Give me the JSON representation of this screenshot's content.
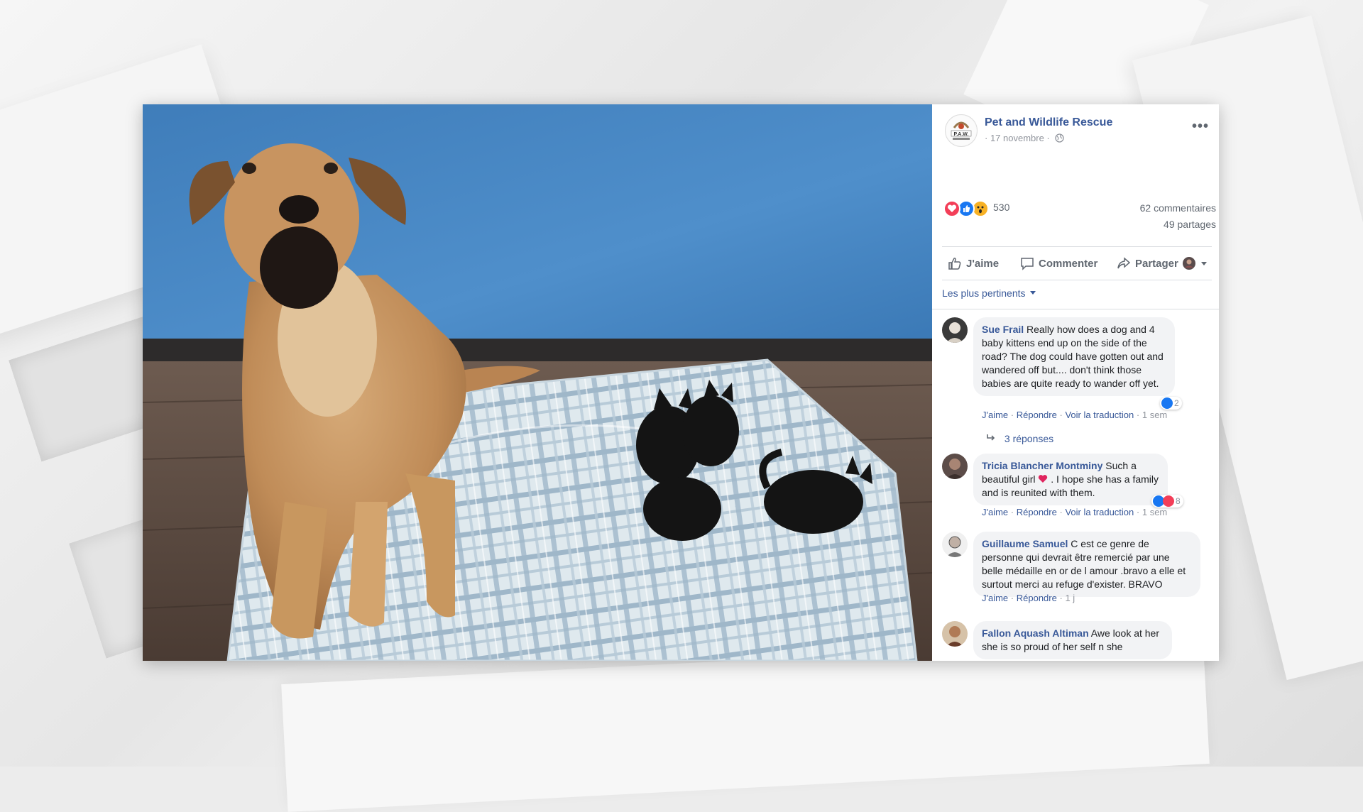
{
  "post": {
    "page_name": "Pet and Wildlife Rescue",
    "logo_text": "P.A.W.",
    "date": "· 17 novembre ·",
    "more_label": "•••"
  },
  "stats": {
    "reactions_count": "530",
    "comments_count": "62 commentaires",
    "shares_count": "49 partages",
    "reaction_types": [
      "love",
      "like",
      "wow"
    ]
  },
  "actions": {
    "like": "J'aime",
    "comment": "Commenter",
    "share": "Partager"
  },
  "sort": {
    "label": "Les plus pertinents"
  },
  "comments": [
    {
      "author": "Sue Frail",
      "text": "Really how does a dog and 4 baby kittens end up on the side of the road? The dog could have gotten out and wandered off but.... don't think those babies are quite ready to wander off yet.",
      "like": "J'aime",
      "reply": "Répondre",
      "translate": "Voir la traduction",
      "time": "1 sem",
      "reactions": "2",
      "replies": "3 réponses"
    },
    {
      "author": "Tricia Blancher Montminy",
      "text_before": "Such a beautiful girl",
      "text_after": ". I hope she has a family and is reunited with them.",
      "like": "J'aime",
      "reply": "Répondre",
      "translate": "Voir la traduction",
      "time": "1 sem",
      "reactions": "8"
    },
    {
      "author": "Guillaume Samuel",
      "text": "C est ce genre de personne qui devrait être remercié par une belle médaille en or de l amour .bravo a elle et surtout merci au refuge d'exister. BRAVO",
      "like": "J'aime",
      "reply": "Répondre",
      "time": "1 j"
    },
    {
      "author": "Fallon Aquash Altiman",
      "text": "Awe look at her she is so proud of her self n she"
    }
  ],
  "colors": {
    "link_blue": "#385898",
    "like_blue": "#1877f2",
    "love_red": "#f33e58",
    "wow_yellow": "#f7b125"
  }
}
